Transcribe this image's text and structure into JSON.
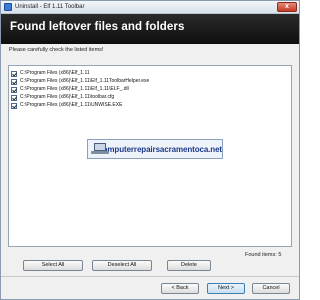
{
  "window": {
    "title": "Uninstall - Elf 1.11 Toolbar",
    "close_label": "x"
  },
  "header": {
    "title": "Found leftover files and folders"
  },
  "instruction": "Please carefully check the listed items!",
  "items": [
    {
      "label": "C:\\Program Files (x86)\\Elf_1.11",
      "checked": true
    },
    {
      "label": "C:\\Program Files (x86)\\Elf_1.11\\Elf_1.11ToolbarHelper.exe",
      "checked": true
    },
    {
      "label": "C:\\Program Files (x86)\\Elf_1.11\\Elf_1.11\\ELF_.dll",
      "checked": true
    },
    {
      "label": "C:\\Program Files (x86)\\Elf_1.11\\toolbar.cfg",
      "checked": true
    },
    {
      "label": "C:\\Program Files (x86)\\Elf_1.11\\UNWISE.EXE",
      "checked": true
    }
  ],
  "watermark": {
    "text": "computerrepairsacramentoca.net"
  },
  "found_items": "Found items: 5",
  "buttons": {
    "select_all": "Select All",
    "deselect_all": "Deselect All",
    "delete": "Delete",
    "back": "< Back",
    "next": "Next >",
    "cancel": "Cancel"
  }
}
